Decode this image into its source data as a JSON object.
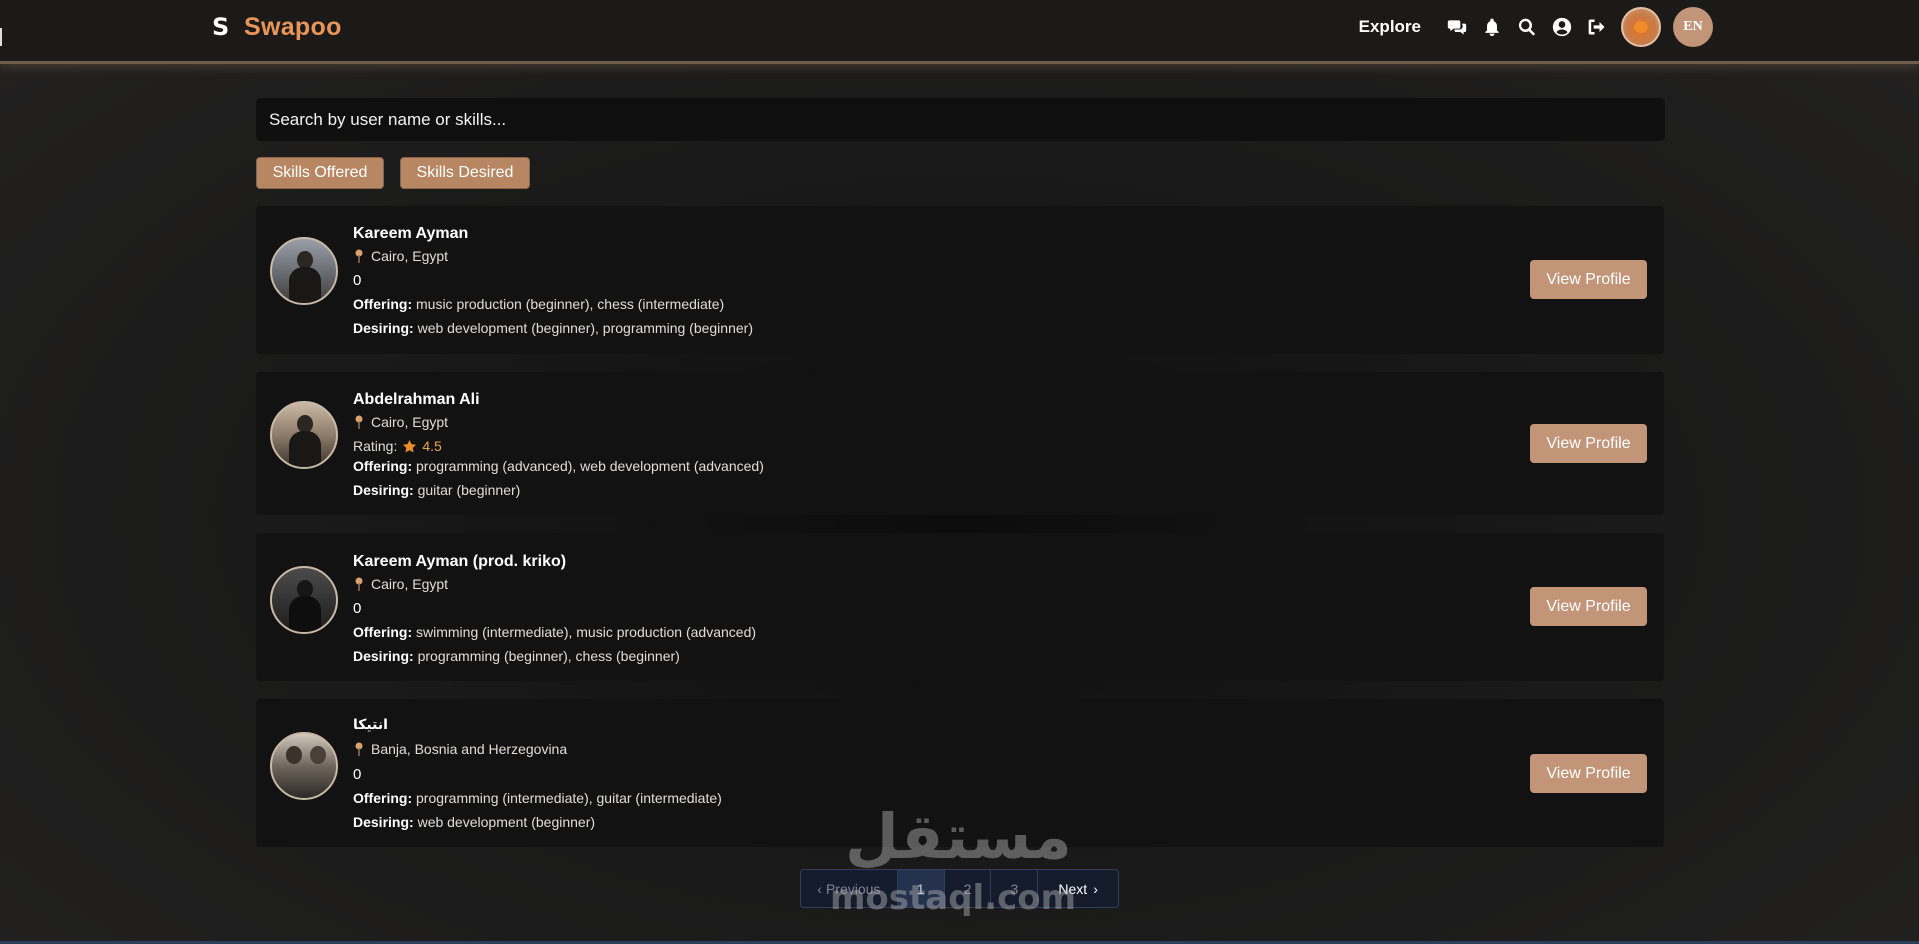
{
  "app": {
    "name": "Swapoo",
    "brand_color": "#e9955a",
    "accent_color": "#c29579"
  },
  "nav": {
    "explore_label": "Explore",
    "icons": [
      "chat-icon",
      "bell-icon",
      "search-icon",
      "user-icon",
      "logout-icon"
    ],
    "language_label": "EN"
  },
  "search": {
    "placeholder": "Search by user name or skills..."
  },
  "filters": {
    "offered_label": "Skills Offered",
    "desired_label": "Skills Desired"
  },
  "labels": {
    "offering": "Offering:",
    "desiring": "Desiring:",
    "rating": "Rating:",
    "view_profile": "View Profile"
  },
  "users": [
    {
      "name": "Kareem Ayman",
      "location": "Cairo, Egypt",
      "score": "0",
      "offering": "music production (beginner), chess (intermediate)",
      "desiring": "web development (beginner), programming (beginner)"
    },
    {
      "name": "Abdelrahman Ali",
      "location": "Cairo, Egypt",
      "rating": "4.5",
      "offering": "programming (advanced), web development (advanced)",
      "desiring": "guitar (beginner)"
    },
    {
      "name": "Kareem Ayman (prod. kriko)",
      "location": "Cairo, Egypt",
      "score": "0",
      "offering": "swimming (intermediate), music production (advanced)",
      "desiring": "programming (beginner), chess (beginner)"
    },
    {
      "name": "انتيكا",
      "location": "Banja, Bosnia and Herzegovina",
      "score": "0",
      "offering": "programming (intermediate), guitar (intermediate)",
      "desiring": "web development (beginner)"
    }
  ],
  "pagination": {
    "previous_label": "Previous",
    "pages": [
      "1",
      "2",
      "3"
    ],
    "current_page": 1,
    "next_label": "Next"
  },
  "watermark": {
    "arabic": "مستقل",
    "latin": "mostaql.com"
  }
}
